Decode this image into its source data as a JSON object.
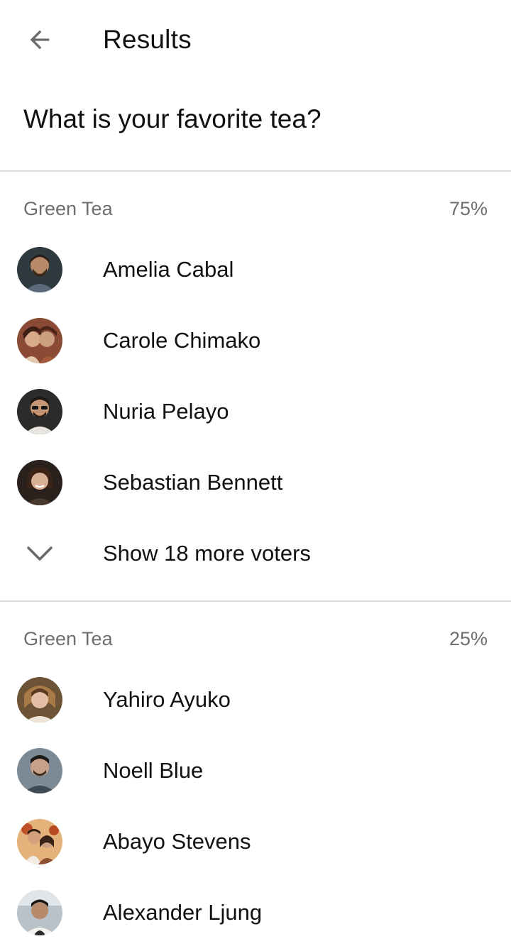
{
  "header": {
    "title": "Results",
    "back_icon": "arrow-back-icon"
  },
  "question": "What is your favorite tea?",
  "options": [
    {
      "label": "Green Tea",
      "percent": "75%",
      "voters": [
        {
          "name": "Amelia Cabal",
          "avatar_color": "#5a4636"
        },
        {
          "name": "Carole Chimako",
          "avatar_color": "#7a3b2e"
        },
        {
          "name": "Nuria Pelayo",
          "avatar_color": "#3b3a3a"
        },
        {
          "name": "Sebastian Bennett",
          "avatar_color": "#2e2420"
        }
      ],
      "more_label": "Show 18 more voters",
      "more_icon": "chevron-down-icon"
    },
    {
      "label": "Green Tea",
      "percent": "25%",
      "voters": [
        {
          "name": "Yahiro Ayuko",
          "avatar_color": "#8a6a4a"
        },
        {
          "name": "Noell Blue",
          "avatar_color": "#56606a"
        },
        {
          "name": "Abayo Stevens",
          "avatar_color": "#c8874a"
        },
        {
          "name": "Alexander Ljung",
          "avatar_color": "#3a3530"
        }
      ]
    }
  ],
  "colors": {
    "text_primary": "#111111",
    "text_secondary": "#6f6f6f",
    "divider": "#dedede",
    "icon": "#6b6b6b"
  }
}
